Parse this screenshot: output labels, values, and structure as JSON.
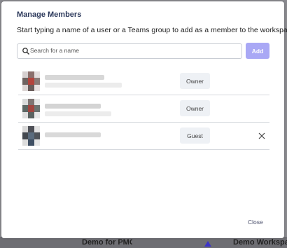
{
  "dialog": {
    "title": "Manage Members",
    "subtitle": "Start typing a name of a user or a Teams group to add as a member to the workspace.",
    "search": {
      "placeholder": "Search for a name",
      "value": ""
    },
    "add_label": "Add",
    "close_label": "Close"
  },
  "members": [
    {
      "role": "Owner",
      "removable": false
    },
    {
      "role": "Owner",
      "removable": false
    },
    {
      "role": "Guest",
      "removable": true
    }
  ],
  "background": {
    "left_label": "Demo for PMC",
    "right_label": "Demo Workspace"
  },
  "colors": {
    "accent_disabled": "#a9a8f5",
    "title": "#2d3a5c",
    "badge_bg": "#eef1f5"
  }
}
